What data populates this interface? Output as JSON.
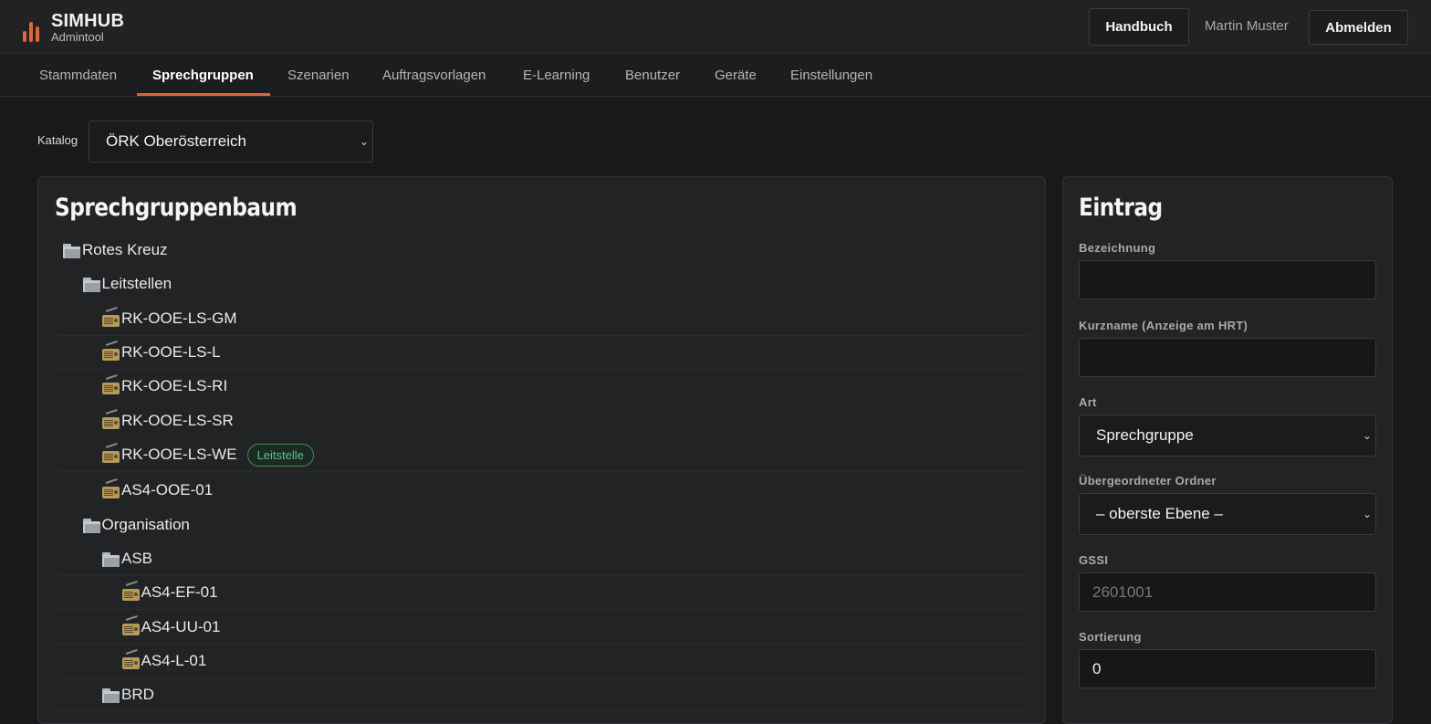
{
  "header": {
    "brand_name": "SIMHUB",
    "brand_sub": "Admintool",
    "manual_label": "Handbuch",
    "user_name": "Martin Muster",
    "logout_label": "Abmelden",
    "accent_color": "#e0663a"
  },
  "nav": {
    "tabs": [
      {
        "label": "Stammdaten"
      },
      {
        "label": "Sprechgruppen"
      },
      {
        "label": "Szenarien"
      },
      {
        "label": "Auftragsvorlagen"
      },
      {
        "label": "E-Learning"
      },
      {
        "label": "Benutzer"
      },
      {
        "label": "Geräte"
      },
      {
        "label": "Einstellungen"
      }
    ],
    "active": "Sprechgruppen"
  },
  "catalog": {
    "label": "Katalog",
    "selected": "ÖRK Oberösterreich"
  },
  "tree": {
    "title": "Sprechgruppenbaum",
    "items": [
      {
        "label": "Rotes Kreuz",
        "icon": "folder-icon"
      },
      {
        "label": "Leitstellen",
        "icon": "folder-icon"
      },
      {
        "label": "RK-OOE-LS-GM",
        "icon": "radio-icon"
      },
      {
        "label": "RK-OOE-LS-L",
        "icon": "radio-icon"
      },
      {
        "label": "RK-OOE-LS-RI",
        "icon": "radio-icon"
      },
      {
        "label": "RK-OOE-LS-SR",
        "icon": "radio-icon"
      },
      {
        "label": "RK-OOE-LS-WE",
        "icon": "radio-icon",
        "badge": "Leitstelle"
      },
      {
        "label": "AS4-OOE-01",
        "icon": "radio-icon"
      },
      {
        "label": "Organisation",
        "icon": "folder-icon"
      },
      {
        "label": "ASB",
        "icon": "folder-icon"
      },
      {
        "label": "AS4-EF-01",
        "icon": "radio-icon"
      },
      {
        "label": "AS4-UU-01",
        "icon": "radio-icon"
      },
      {
        "label": "AS4-L-01",
        "icon": "radio-icon"
      },
      {
        "label": "BRD",
        "icon": "folder-icon"
      }
    ]
  },
  "entry": {
    "title": "Eintrag",
    "fields": {
      "bezeichnung": {
        "label": "Bezeichnung",
        "value": ""
      },
      "kurzname": {
        "label": "Kurzname (Anzeige am HRT)",
        "value": ""
      },
      "art": {
        "label": "Art",
        "value": "Sprechgruppe"
      },
      "ordner": {
        "label": "Übergeordneter Ordner",
        "value": "– oberste Ebene –"
      },
      "gssi": {
        "label": "GSSI",
        "placeholder": "2601001"
      },
      "sortierung": {
        "label": "Sortierung",
        "value": "0"
      }
    }
  }
}
